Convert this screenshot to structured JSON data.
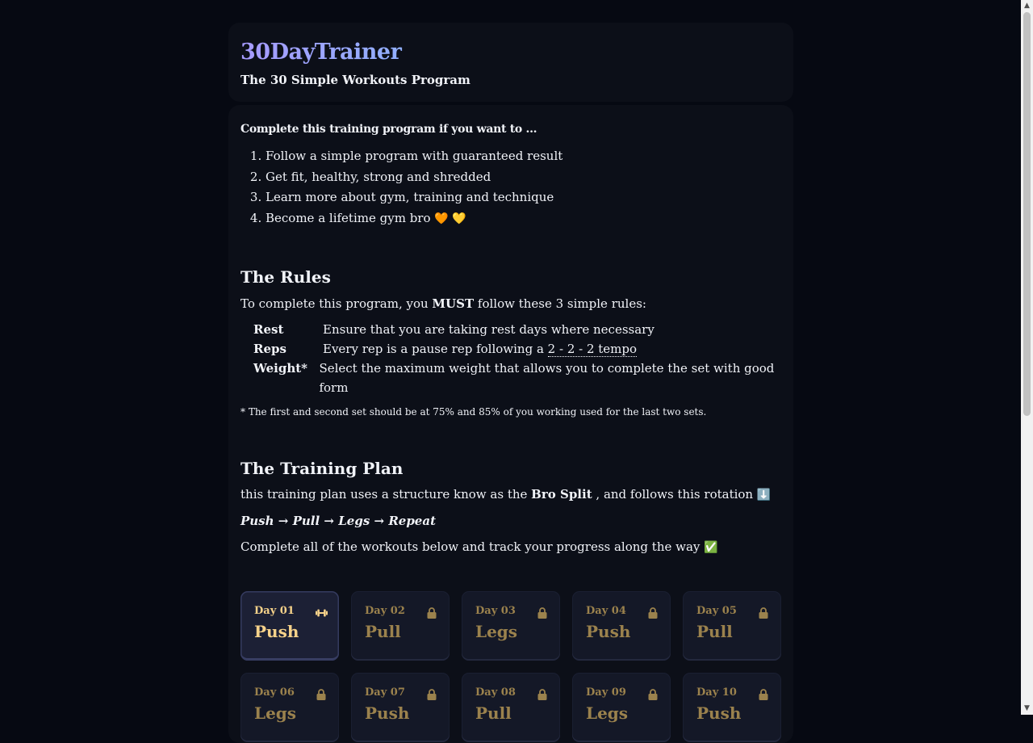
{
  "header": {
    "logo": "30DayTrainer",
    "subtitle": "The 30 Simple Workouts Program"
  },
  "intro": {
    "heading": "Complete this training program if you want to ...",
    "goals": [
      "Follow a simple program with guaranteed result",
      "Get fit, healthy, strong and shredded",
      "Learn more about gym, training and technique",
      "Become a lifetime gym bro"
    ],
    "goal_emojis": "🧡 💛"
  },
  "rules": {
    "title": "The Rules",
    "intro_before": "To complete this program, you",
    "intro_strong": "MUST",
    "intro_after": "follow these 3 simple rules:",
    "items": [
      {
        "name": "Rest",
        "desc": "Ensure that you are taking rest days where necessary"
      },
      {
        "name": "Reps",
        "desc": "Every rep is a pause rep following a",
        "link": "2 - 2 - 2 tempo"
      },
      {
        "name": "Weight*",
        "desc": "Select the maximum weight that allows you to complete the set with good form"
      }
    ],
    "footnote": "* The first and second set should be at 75% and 85% of you working used for the last two sets."
  },
  "plan": {
    "title": "The Training Plan",
    "desc_before": "this training plan uses a structure know as the",
    "desc_strong": "Bro Split",
    "desc_after": ", and follows this rotation",
    "desc_emoji": "⬇️",
    "rotation": [
      "Push",
      "Pull",
      "Legs",
      "Repeat"
    ],
    "rotation_arrow": "→",
    "track_text": "Complete all of the workouts below and track your progress along the way",
    "track_emoji": "✅"
  },
  "days": [
    {
      "label": "Day 01",
      "type": "Push",
      "status": "active",
      "icon": "dumbbell-icon"
    },
    {
      "label": "Day 02",
      "type": "Pull",
      "status": "locked",
      "icon": "lock-icon"
    },
    {
      "label": "Day 03",
      "type": "Legs",
      "status": "locked",
      "icon": "lock-icon"
    },
    {
      "label": "Day 04",
      "type": "Push",
      "status": "locked",
      "icon": "lock-icon"
    },
    {
      "label": "Day 05",
      "type": "Pull",
      "status": "locked",
      "icon": "lock-icon"
    },
    {
      "label": "Day 06",
      "type": "Legs",
      "status": "locked",
      "icon": "lock-icon"
    },
    {
      "label": "Day 07",
      "type": "Push",
      "status": "locked",
      "icon": "lock-icon"
    },
    {
      "label": "Day 08",
      "type": "Pull",
      "status": "locked",
      "icon": "lock-icon"
    },
    {
      "label": "Day 09",
      "type": "Legs",
      "status": "locked",
      "icon": "lock-icon"
    },
    {
      "label": "Day 10",
      "type": "Push",
      "status": "locked",
      "icon": "lock-icon"
    }
  ],
  "colors": {
    "background": "#060912",
    "card": "#0c0f18",
    "active_accent": "#f6d28a",
    "locked_accent": "#9b824d",
    "logo_gradient": [
      "#a79bff",
      "#7fc1ff",
      "#8fe9d3"
    ]
  }
}
